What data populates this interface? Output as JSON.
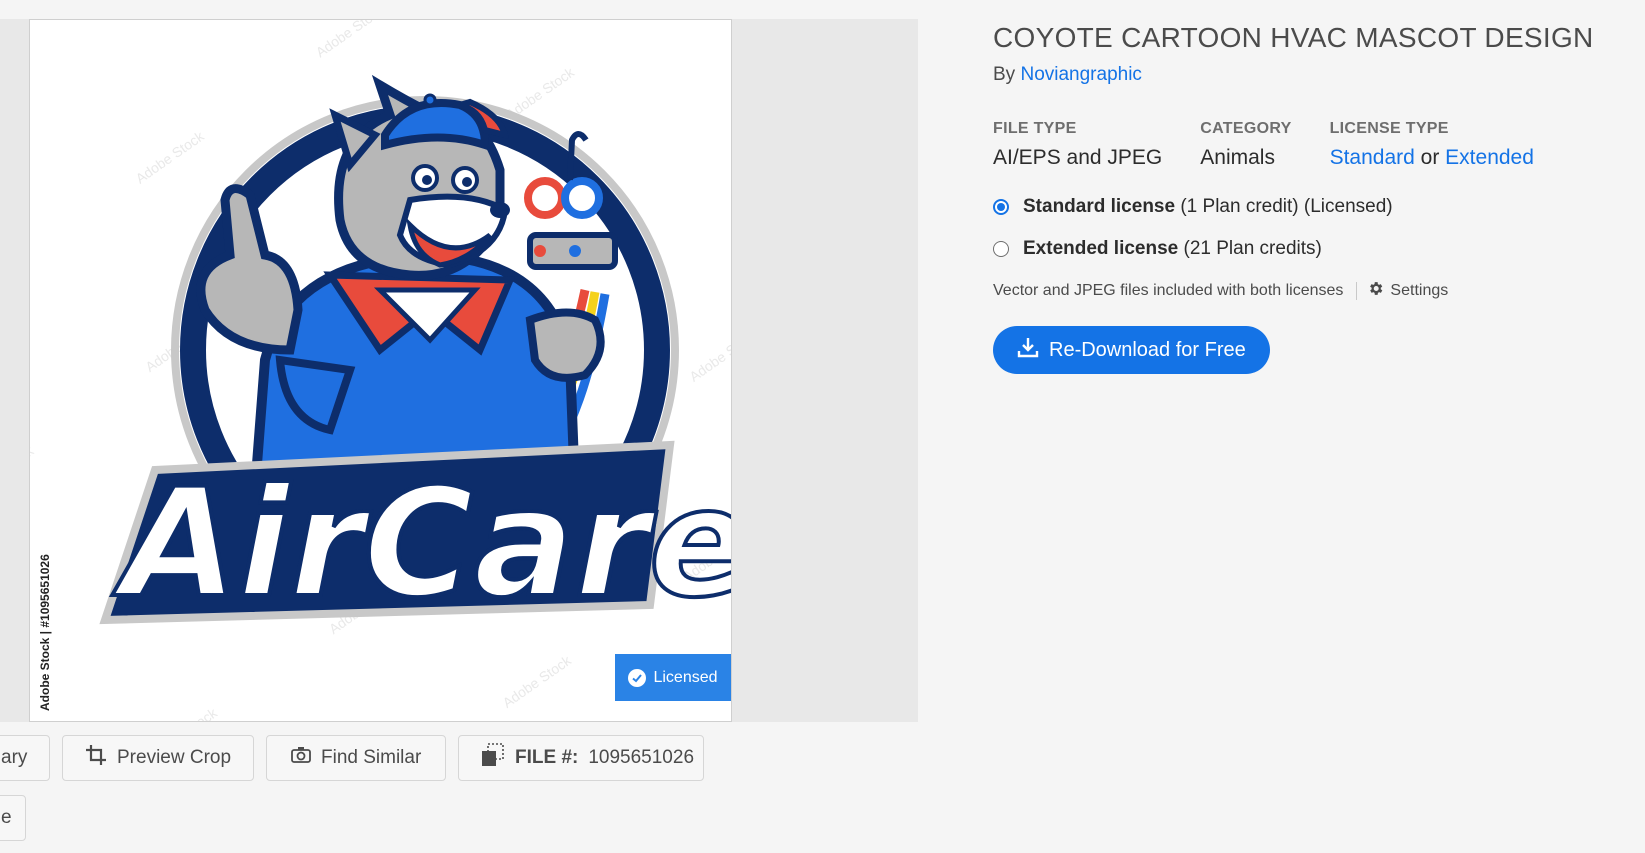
{
  "asset": {
    "title": "COYOTE CARTOON HVAC MASCOT DESIGN",
    "by_label": "By",
    "author": "Noviangraphic",
    "watermark_side": "Adobe Stock | #1095651026",
    "image_wordmark": "AirCare",
    "licensed_badge": "Licensed"
  },
  "meta": {
    "file_type_label": "FILE TYPE",
    "file_type_value": "AI/EPS and JPEG",
    "category_label": "CATEGORY",
    "category_value": "Animals",
    "license_type_label": "LICENSE TYPE",
    "license_standard": "Standard",
    "license_or": "or",
    "license_extended": "Extended"
  },
  "licenses": {
    "standard_name": "Standard license",
    "standard_detail": "(1 Plan credit) (Licensed)",
    "standard_selected": true,
    "extended_name": "Extended license",
    "extended_detail": "(21 Plan credits)",
    "extended_selected": false,
    "info_text": "Vector and JPEG files included with both licenses",
    "settings_label": "Settings"
  },
  "download": {
    "label": "Re-Download for Free"
  },
  "actions": {
    "library_partial": "ary",
    "preview_crop": "Preview Crop",
    "find_similar": "Find Similar",
    "file_label": "FILE #:",
    "file_number": "1095651026",
    "second_partial": "e"
  },
  "colors": {
    "accent": "#1473e6",
    "badge": "#2a83e6",
    "mascot_navy": "#0d2d6b",
    "mascot_blue": "#1f6fe0",
    "mascot_red": "#e84b3c",
    "mascot_gray": "#b7b7b7"
  }
}
